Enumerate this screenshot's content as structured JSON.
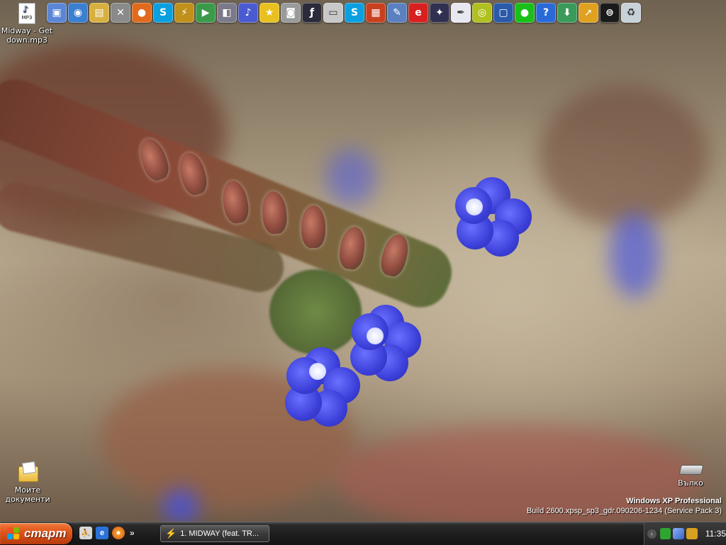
{
  "desktop": {
    "icons": {
      "mp3_file": {
        "label": "Midway - Get down.mp3",
        "badge": "MP3"
      },
      "my_documents": {
        "label": "Моите документи"
      },
      "drive": {
        "label": "Вълко"
      }
    },
    "os_info": {
      "name": "Windows XP Professional",
      "build": "Build 2600.xpsp_sp3_gdr.090206-1234 (Service Pack 3)"
    }
  },
  "top_icons": [
    "computer-icon",
    "network-icon",
    "folder-icon",
    "tools-icon",
    "firefox-icon",
    "skype-icon",
    "winamp-icon",
    "media-icon",
    "speaker-icon",
    "music-icon",
    "star-icon",
    "camera-icon",
    "flash-icon",
    "presentation-icon",
    "skype-icon",
    "video-icon",
    "xml-icon",
    "editor-icon",
    "image-icon",
    "feather-icon",
    "disc-icon",
    "tv-icon",
    "green-circle-icon",
    "help-icon",
    "install-icon",
    "shortcut-icon",
    "ea-icon",
    "recycle-bin-icon"
  ],
  "taskbar": {
    "start_label": "старт",
    "quick_launch_chevron": "»",
    "task_button_label": "1. MIDWAY (feat. TR...",
    "clock": "11:35"
  },
  "colors": {
    "start_orange": "#e0561c",
    "taskbar_dark": "#1c1c1c",
    "flower_blue": "#3b3fd8"
  }
}
